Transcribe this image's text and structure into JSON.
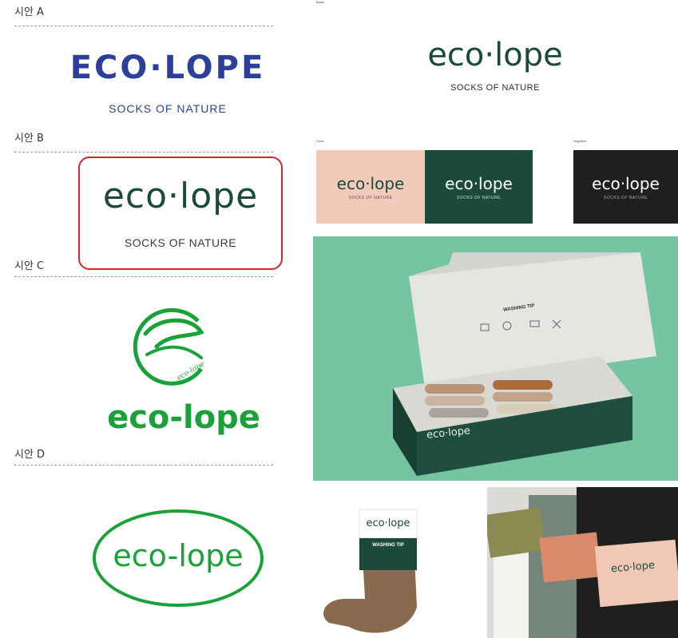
{
  "options": {
    "a": {
      "label": "시안 A",
      "logo": "ECO·LOPE",
      "tagline": "SOCKS OF NATURE"
    },
    "b": {
      "label": "시안 B",
      "logo": "eco·lope",
      "tagline": "SOCKS OF NATURE"
    },
    "c": {
      "label": "시안 C",
      "emblem_text": "eco-lope",
      "logo": "eco-lope"
    },
    "d": {
      "label": "시안 D",
      "logo": "eco-lope"
    }
  },
  "board": {
    "basic": {
      "caption": "Basic",
      "logo": "eco·lope",
      "tagline": "SOCKS OF NATURE"
    },
    "color": {
      "caption": "Color",
      "logo": "eco·lope",
      "tagline": "SOCKS OF NATURE"
    },
    "negative": {
      "caption": "Negative",
      "logo": "eco·lope",
      "tagline": "SOCKS OF NATURE"
    },
    "box": {
      "title": "WASHING TIP",
      "logo": "eco·lope"
    },
    "sock_tag": {
      "logo": "eco·lope",
      "title": "WASHING TIP"
    },
    "bands": {
      "logo": "eco·lope"
    }
  },
  "colors": {
    "blue": "#2d3f9b",
    "dark_green": "#1b4a3d",
    "pink": "#f3c9b9",
    "mint": "#74c5a0",
    "bright_green": "#1aa23a",
    "highlight_red": "#d9242b"
  }
}
